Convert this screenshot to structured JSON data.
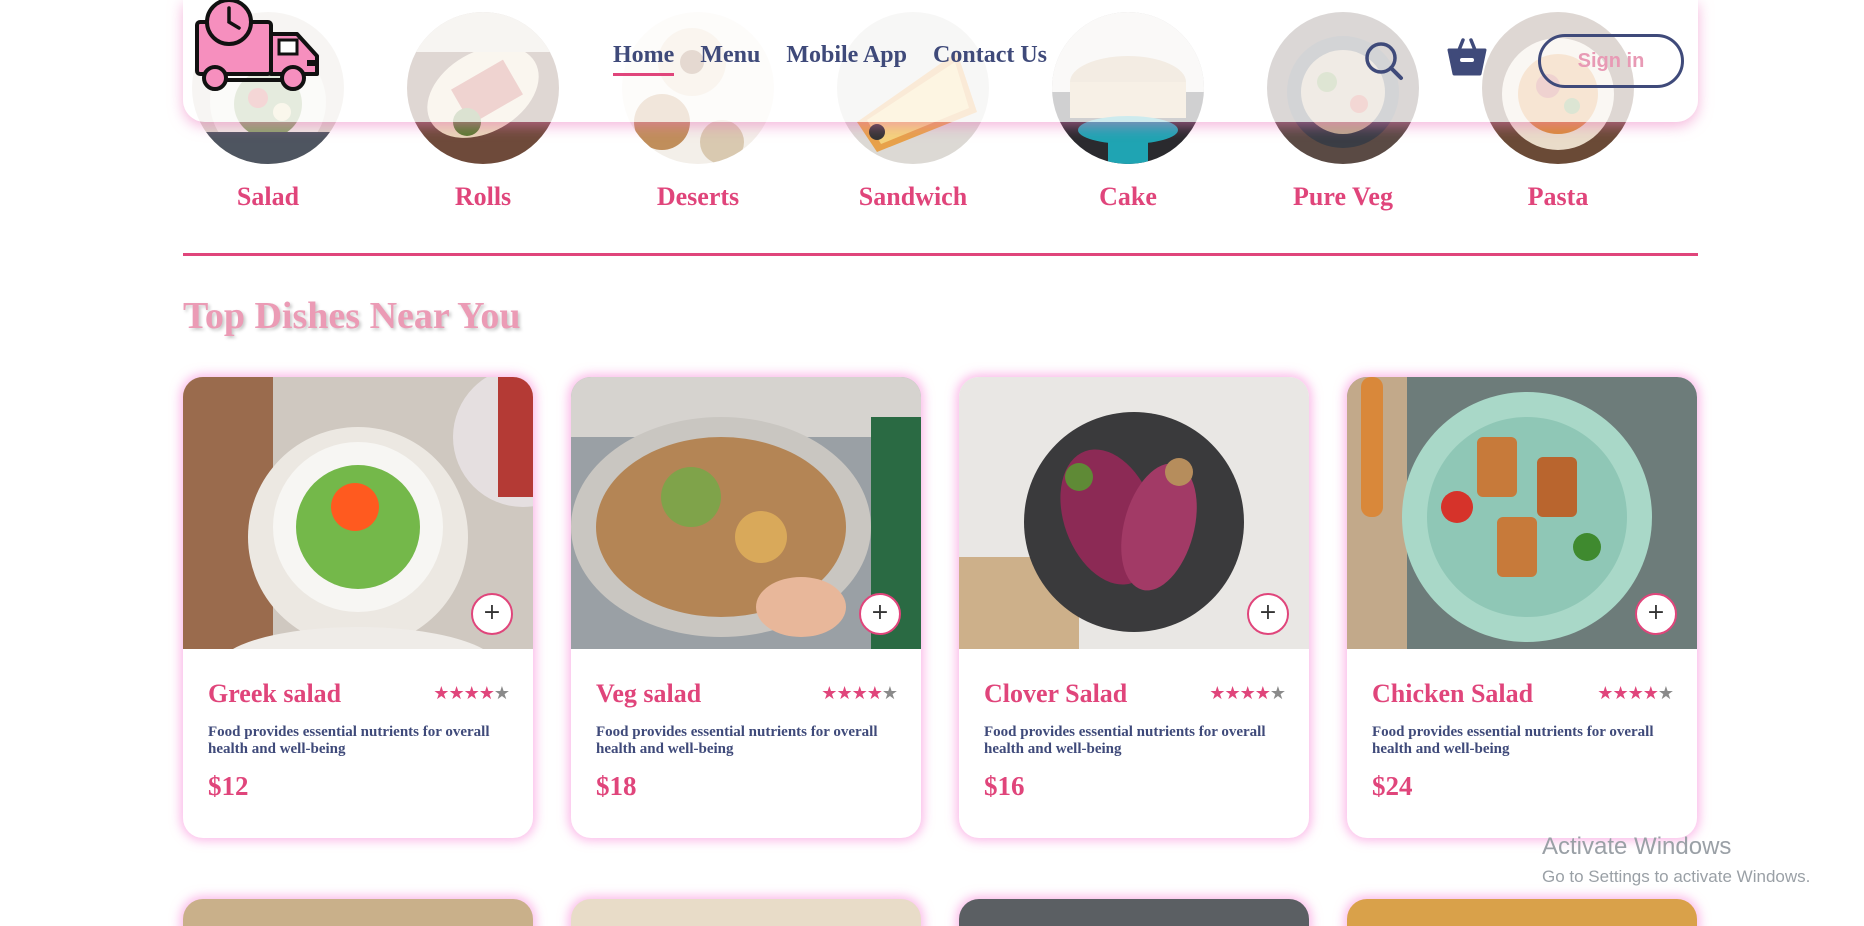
{
  "nav": {
    "links": [
      {
        "label": "Home",
        "active": true
      },
      {
        "label": "Menu"
      },
      {
        "label": "Mobile App"
      },
      {
        "label": "Contact Us"
      }
    ],
    "search_icon": "search-icon",
    "basket_icon": "basket-icon",
    "signin_label": "Sign in"
  },
  "categories": [
    {
      "label": "Salad"
    },
    {
      "label": "Rolls"
    },
    {
      "label": "Deserts"
    },
    {
      "label": "Sandwich"
    },
    {
      "label": "Cake"
    },
    {
      "label": "Pure Veg"
    },
    {
      "label": "Pasta"
    }
  ],
  "section": {
    "title": "Top Dishes Near You"
  },
  "dishes": [
    {
      "name": "Greek salad",
      "rating": 4,
      "rating_max": 5,
      "description": "Food provides essential nutrients for overall health and well-being",
      "price": "$12"
    },
    {
      "name": "Veg salad",
      "rating": 4,
      "rating_max": 5,
      "description": "Food provides essential nutrients for overall health and well-being",
      "price": "$18"
    },
    {
      "name": "Clover Salad",
      "rating": 4,
      "rating_max": 5,
      "description": "Food provides essential nutrients for overall health and well-being",
      "price": "$16"
    },
    {
      "name": "Chicken Salad",
      "rating": 4,
      "rating_max": 5,
      "description": "Food provides essential nutrients for overall health and well-being",
      "price": "$24"
    }
  ],
  "add_button_label": "+",
  "watermark": {
    "title": "Activate Windows",
    "subtitle": "Go to Settings to activate Windows."
  },
  "colors": {
    "accent": "#e0457b",
    "navy": "#3f4a7a",
    "heading_pink": "#eb9bb5",
    "glow": "#f785d7",
    "logo_pink": "#f68fbe"
  }
}
